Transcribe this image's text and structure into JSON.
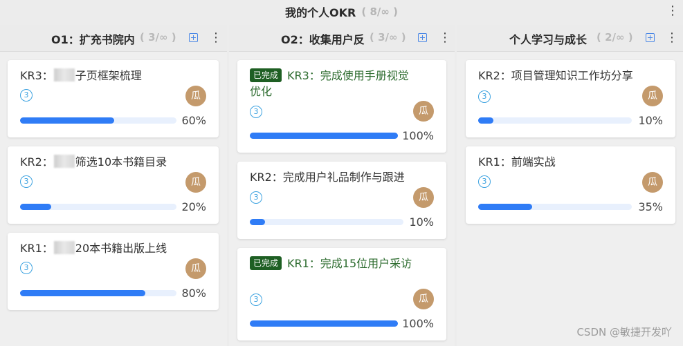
{
  "board": {
    "title": "我的个人OKR",
    "count": "( 8/∞ )"
  },
  "columns": [
    {
      "title": "O1：扩充书院内",
      "count": "( 3/∞ )",
      "cards": [
        {
          "pre": "KR3：",
          "post": "子页框架梳理",
          "blurred": true,
          "number": "3",
          "avatar": "瓜",
          "progress": 60,
          "progress_label": "60%",
          "done": false
        },
        {
          "pre": "KR2：",
          "post": "筛选10本书籍目录",
          "blurred": true,
          "number": "3",
          "avatar": "瓜",
          "progress": 20,
          "progress_label": "20%",
          "done": false
        },
        {
          "pre": "KR1：",
          "post": "20本书籍出版上线",
          "blurred": true,
          "number": "3",
          "avatar": "瓜",
          "progress": 80,
          "progress_label": "80%",
          "done": false
        }
      ]
    },
    {
      "title": "O2：收集用户反",
      "count": "( 3/∞ )",
      "cards": [
        {
          "badge": "已完成",
          "pre": "KR3：完成使用手册视觉优化",
          "post": "",
          "blurred": false,
          "number": "3",
          "avatar": "瓜",
          "progress": 100,
          "progress_label": "100%",
          "done": true
        },
        {
          "pre": "KR2：完成用户礼品制作与跟进",
          "post": "",
          "blurred": false,
          "number": "3",
          "avatar": "瓜",
          "progress": 10,
          "progress_label": "10%",
          "done": false
        },
        {
          "badge": "已完成",
          "pre": "KR1：完成15位用户采访",
          "post": "",
          "blurred": false,
          "number": "3",
          "avatar": "瓜",
          "progress": 100,
          "progress_label": "100%",
          "done": true
        }
      ]
    },
    {
      "title": "个人学习与成长",
      "count": "( 2/∞ )",
      "cards": [
        {
          "pre": "KR2：项目管理知识工作坊分享",
          "post": "",
          "blurred": false,
          "number": "3",
          "avatar": "瓜",
          "progress": 10,
          "progress_label": "10%",
          "done": false
        },
        {
          "pre": "KR1：前端实战",
          "post": "",
          "blurred": false,
          "number": "3",
          "avatar": "瓜",
          "progress": 35,
          "progress_label": "35%",
          "done": false
        }
      ]
    }
  ],
  "icons": {
    "kebab": "more-vertical-icon",
    "add": "add-square-icon",
    "number": "circled-number-icon"
  },
  "colors": {
    "accent": "#2f7cf6",
    "done_badge": "#1e5f23",
    "avatar": "#c49a6c",
    "number": "#3ca2e0"
  },
  "watermark": "CSDN @敏捷开发吖"
}
